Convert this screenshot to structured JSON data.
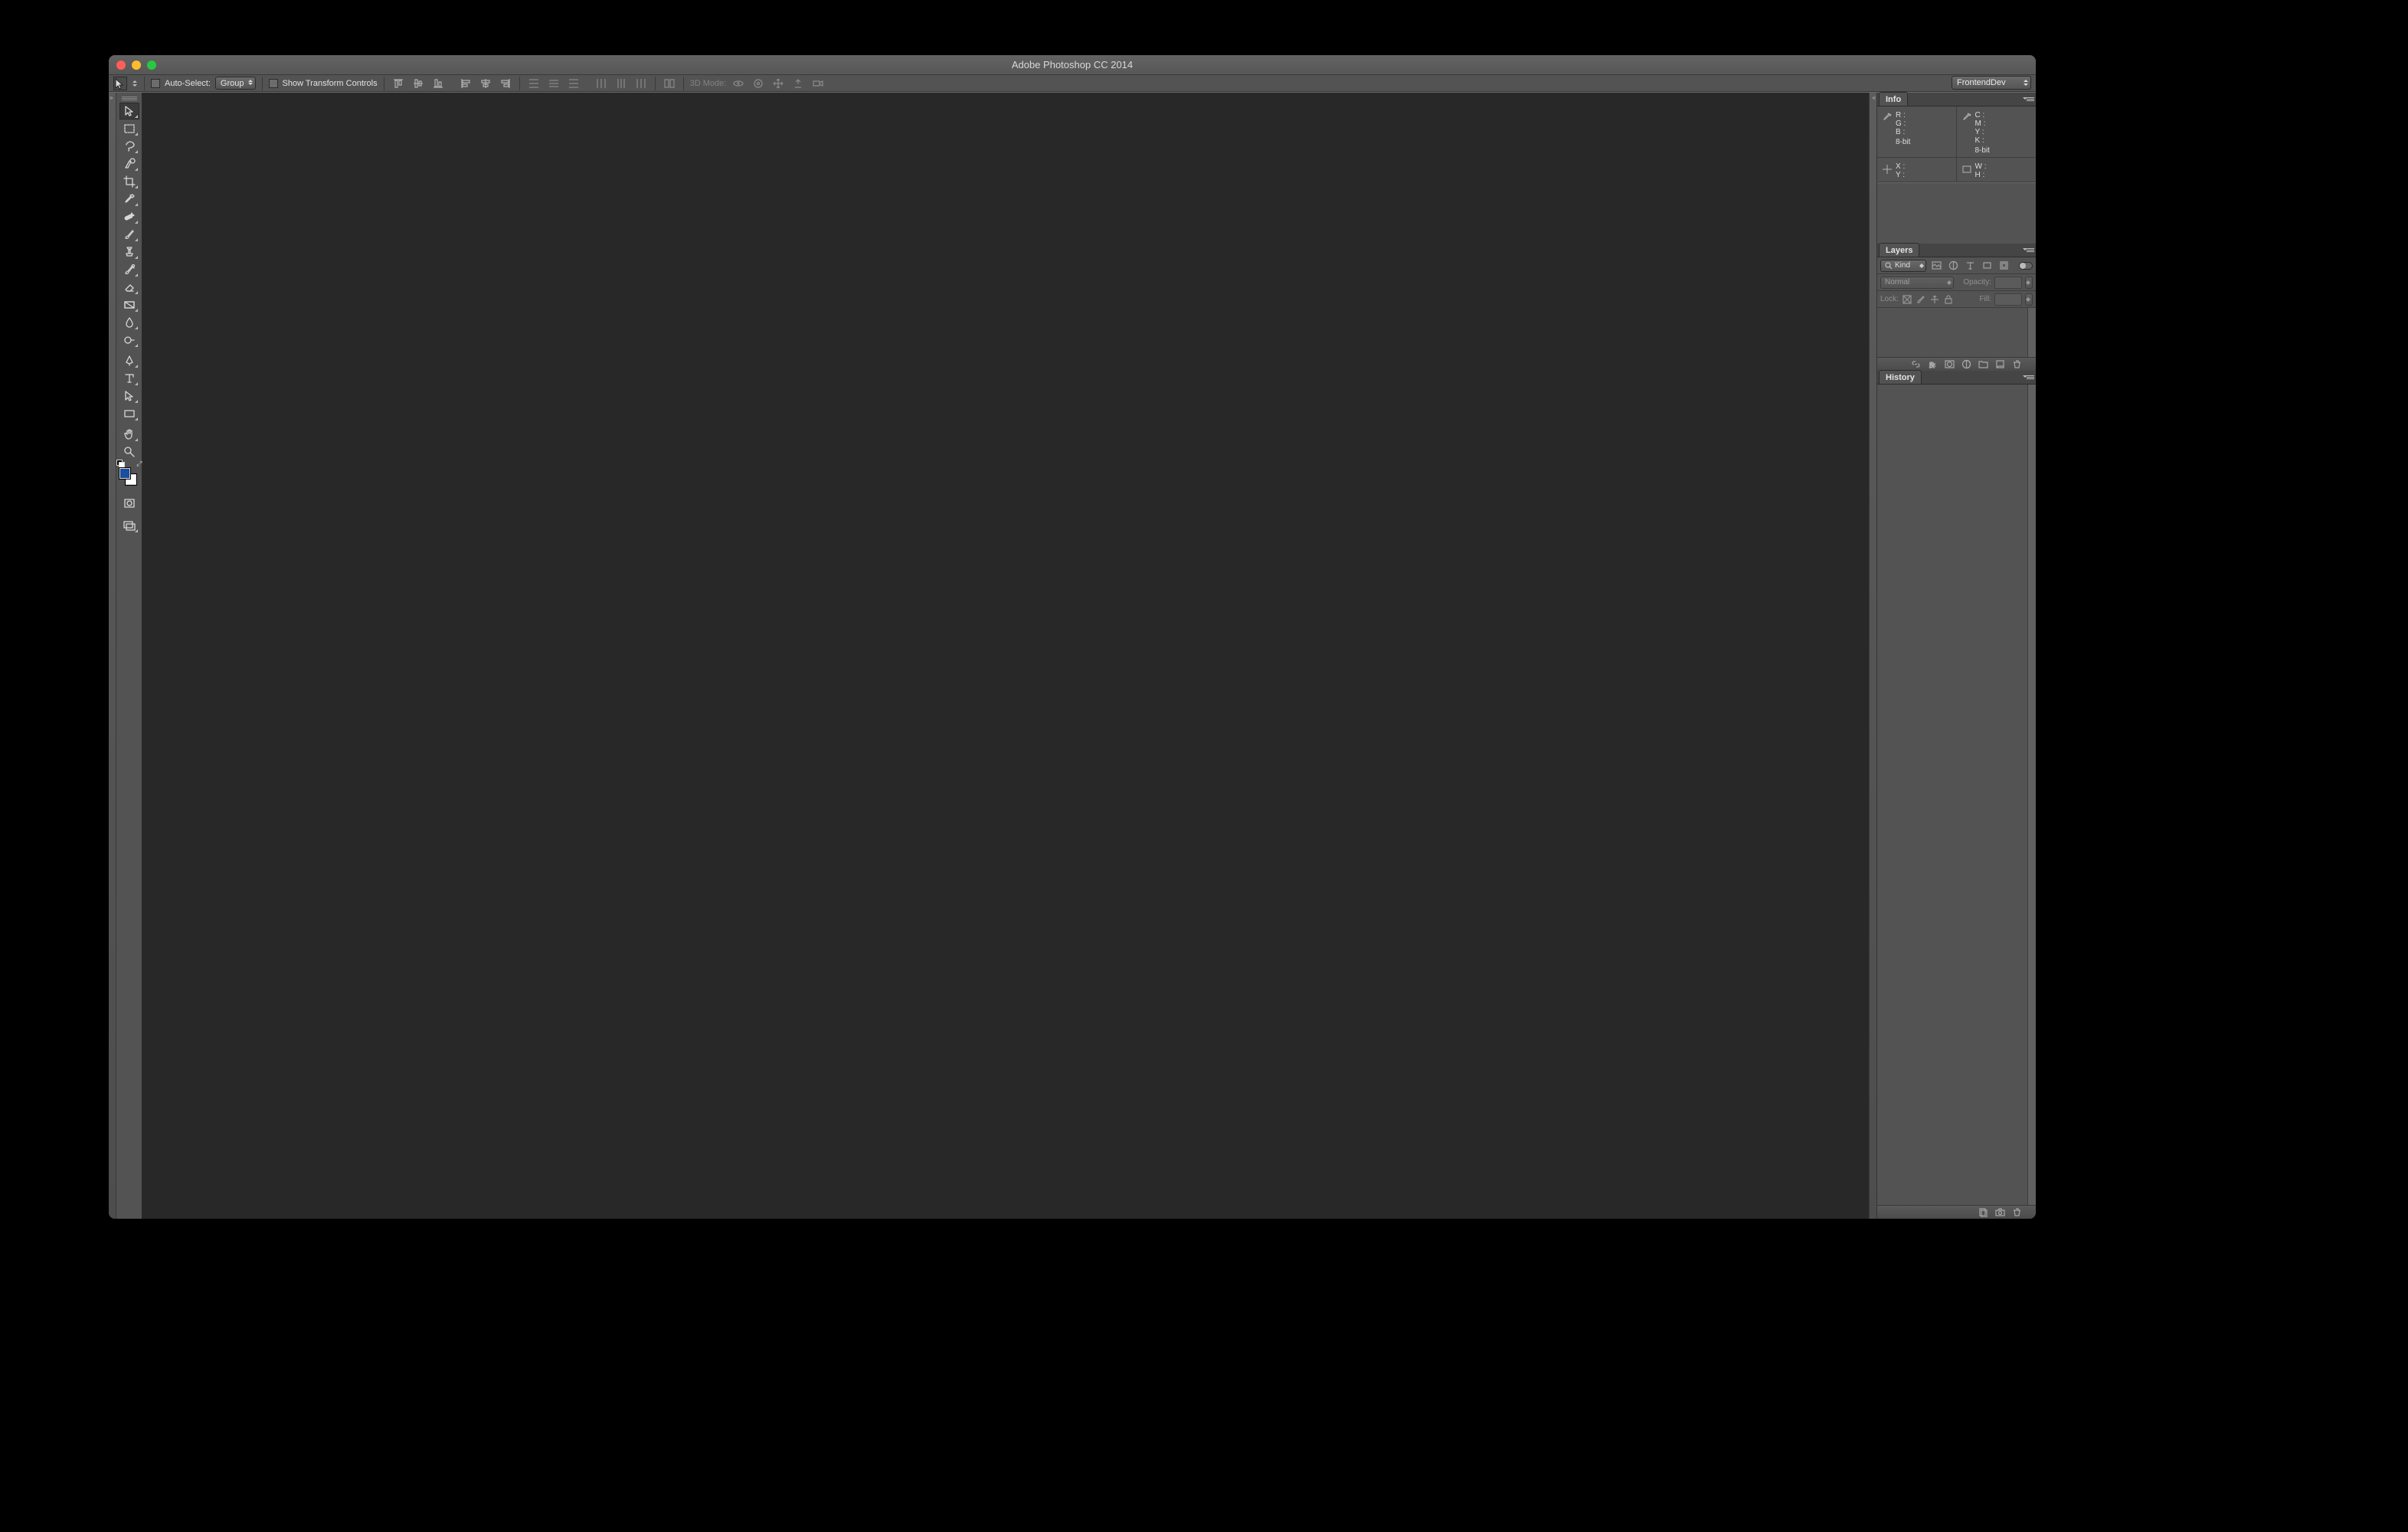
{
  "window": {
    "title": "Adobe Photoshop CC 2014",
    "traffic": {
      "close": "#ff5f57",
      "minimize": "#ffbd2e",
      "zoom": "#28c940"
    }
  },
  "workspace": {
    "current": "FrontendDev"
  },
  "options_bar": {
    "auto_select_label": "Auto-Select:",
    "auto_select_target": "Group",
    "show_transform_label": "Show Transform Controls",
    "mode_3d_label": "3D Mode:"
  },
  "panels": {
    "info": {
      "title": "Info",
      "rgb": {
        "R": "R :",
        "G": "G :",
        "B": "B :",
        "bit": "8-bit"
      },
      "cmyk": {
        "C": "C :",
        "M": "M :",
        "Y": "Y :",
        "K": "K :",
        "bit": "8-bit"
      },
      "pos": {
        "X": "X :",
        "Y": "Y :"
      },
      "dim": {
        "W": "W :",
        "H": "H :"
      }
    },
    "layers": {
      "title": "Layers",
      "kind_label": "Kind",
      "blend_mode": "Normal",
      "opacity_label": "Opacity:",
      "lock_label": "Lock:",
      "fill_label": "Fill:"
    },
    "history": {
      "title": "History"
    }
  },
  "colors": {
    "foreground": "#1a4e9e",
    "background": "#ffffff"
  },
  "tools": [
    "move",
    "rectangular-marquee",
    "lasso",
    "quick-selection",
    "crop",
    "eyedropper",
    "spot-healing-brush",
    "brush",
    "clone-stamp",
    "history-brush",
    "eraser",
    "gradient",
    "blur",
    "dodge",
    "pen",
    "type",
    "path-selection",
    "rectangle",
    "hand",
    "zoom"
  ]
}
